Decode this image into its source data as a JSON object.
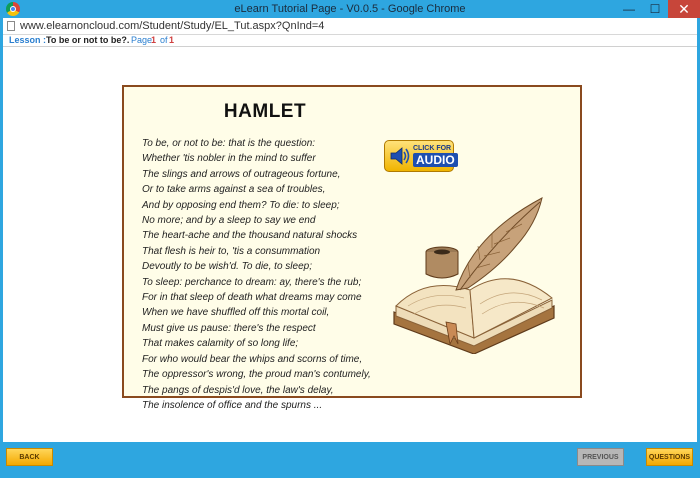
{
  "window": {
    "title": "eLearn Tutorial Page - V0.0.5 - Google Chrome",
    "minimize_glyph": "—",
    "maximize_glyph": "☐",
    "close_glyph": "✕"
  },
  "address_bar": {
    "url": "www.elearnoncloud.com/Student/Study/EL_Tut.aspx?QnInd=4"
  },
  "lesson_bar": {
    "lesson_label": "Lesson :",
    "lesson_title": "To be or not to be?.",
    "page_label": "Page",
    "page_number": "1",
    "of_label": "of",
    "page_total": "1"
  },
  "card": {
    "title": "HAMLET",
    "poem_lines": [
      "To be, or not to be: that is the question:",
      "Whether 'tis nobler in the mind to suffer",
      "The slings and arrows of outrageous fortune,",
      "Or to take arms against a sea of troubles,",
      "And by opposing end them? To die: to sleep;",
      "No more; and by a sleep to say we end",
      "The heart-ache and the thousand natural shocks",
      "That flesh is heir to, 'tis a consummation",
      "Devoutly to be wish'd. To die, to sleep;",
      "To sleep: perchance to dream: ay, there's the rub;",
      "For in that sleep of death what dreams may come",
      "When we have shuffled off this mortal coil,",
      "Must give us pause: there's the respect",
      "That makes calamity of so long life;",
      "For who would bear the whips and scorns of time,",
      "The oppressor's wrong, the proud man's contumely,",
      "The pangs of despis'd love, the law's delay,",
      "The insolence of office and the spurns ..."
    ],
    "audio_button": {
      "line1": "CLICK FOR",
      "line2": "AUDIO"
    }
  },
  "footer": {
    "back_label": "BACK",
    "previous_label": "PREVIOUS",
    "questions_label": "QUESTIONS"
  },
  "colors": {
    "chrome_blue": "#2ea6e0",
    "card_border": "#8a4a1e",
    "card_background": "#fffde8",
    "button_yellow": "#f4a800",
    "button_disabled": "#b7b7b7"
  }
}
